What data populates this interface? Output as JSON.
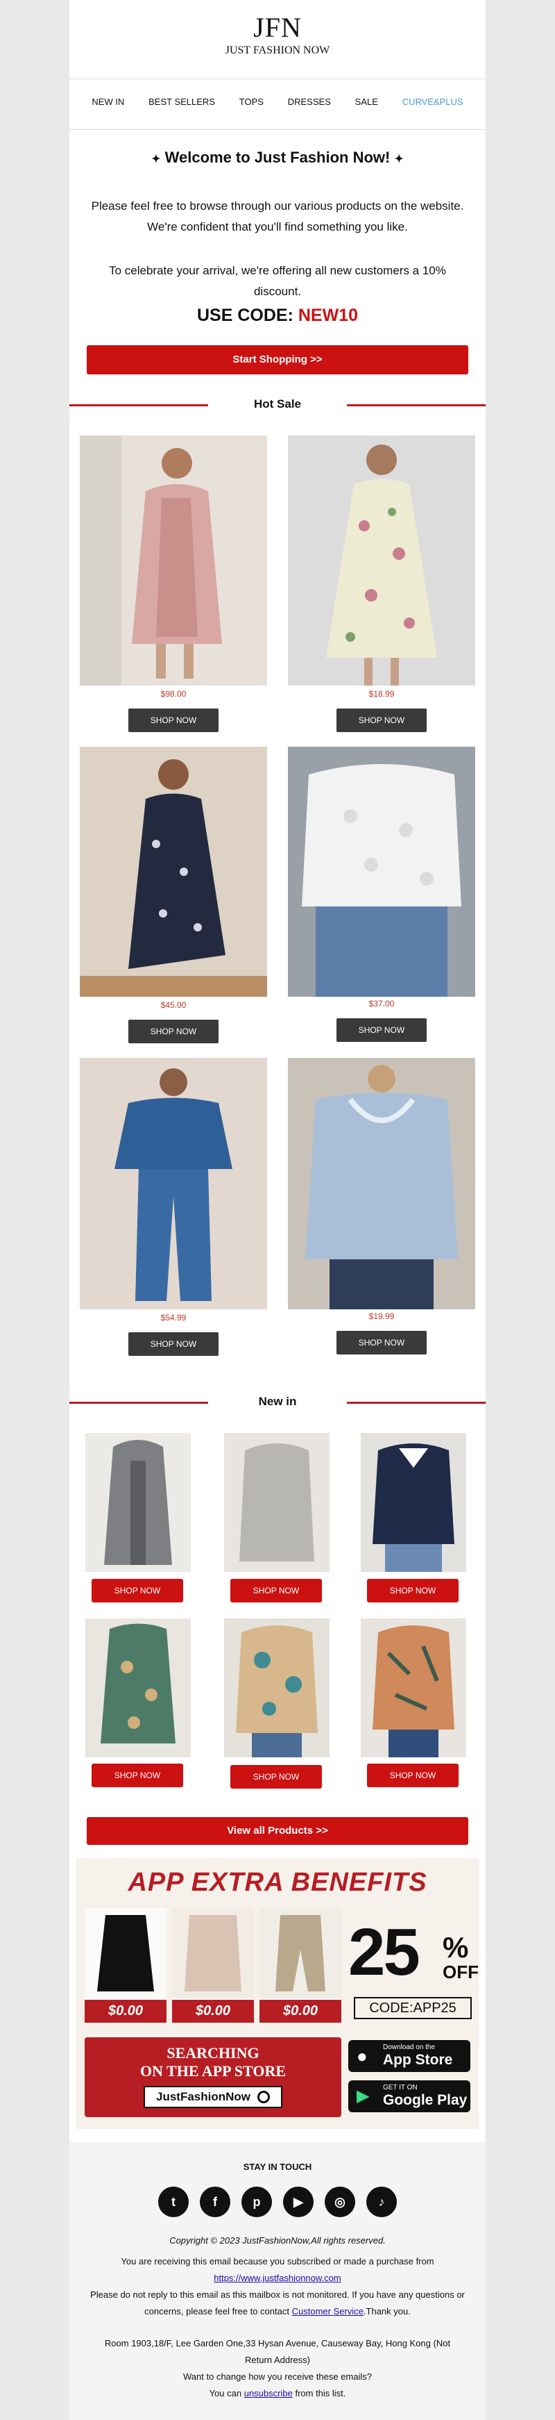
{
  "brand": {
    "logo": "JFN",
    "name": "JUST FASHION NOW"
  },
  "nav": [
    "NEW IN",
    "BEST SELLERS",
    "TOPS",
    "DRESSES",
    "SALE",
    "CURVE&PLUS"
  ],
  "welcome": {
    "title": "Welcome to Just Fashion Now!",
    "para1": "Please feel free to browse through our various products on the website. We're confident that you'll find something you like.",
    "para2": "To celebrate your arrival, we're offering all new customers a 10% discount.",
    "code_label": "USE CODE:",
    "code": "NEW10",
    "cta": "Start Shopping >>"
  },
  "hot_sale": {
    "title": "Hot Sale",
    "button": "SHOP NOW",
    "products": [
      {
        "price": "$98.00"
      },
      {
        "price": "$18.99"
      },
      {
        "price": "$45.00"
      },
      {
        "price": "$37.00"
      },
      {
        "price": "$54.99"
      },
      {
        "price": "$19.99"
      }
    ]
  },
  "new_in": {
    "title": "New in",
    "button": "SHOP NOW",
    "items": 6,
    "view_all": "View all Products >>"
  },
  "app_banner": {
    "headline": "APP EXTRA BENEFITS",
    "prices": [
      "$0.00",
      "$0.00",
      "$0.00"
    ],
    "percent": "25",
    "percent_sign": "%",
    "off": "OFF",
    "code": "CODE:APP25",
    "search_line1": "SEARCHING",
    "search_line2": "ON THE APP STORE",
    "search_term": "JustFashionNow",
    "appstore_small": "Download on the",
    "appstore_big": "App Store",
    "googleplay_small": "GET IT ON",
    "googleplay_big": "Google Play"
  },
  "footer": {
    "stay": "STAY IN TOUCH",
    "social": [
      "twitter-icon",
      "facebook-icon",
      "pinterest-icon",
      "youtube-icon",
      "instagram-icon",
      "tiktok-icon"
    ],
    "copyright": "Copyright © 2023 JustFashionNow,All rights reserved.",
    "receiving": "You are receiving this email because you subscribed or made a purchase from",
    "url": "https://www.justfashionnow.com",
    "noreply_a": "Please do not reply to this email as this mailbox is not monitored. If you have any questions or concerns, please feel free to contact",
    "customer_service": "Customer Service",
    "noreply_b": ".Thank you.",
    "address": "Room 1903,18/F, Lee Garden One,33 Hysan Avenue, Causeway Bay, Hong Kong (Not Return Address)",
    "change": "Want to change how you receive these emails?",
    "unsub_a": "You can",
    "unsub_link": "unsubscribe",
    "unsub_b": "from this list."
  },
  "colors": {
    "accent": "#cc1111",
    "link": "#1a0dab",
    "curve": "#4a9ad8"
  }
}
